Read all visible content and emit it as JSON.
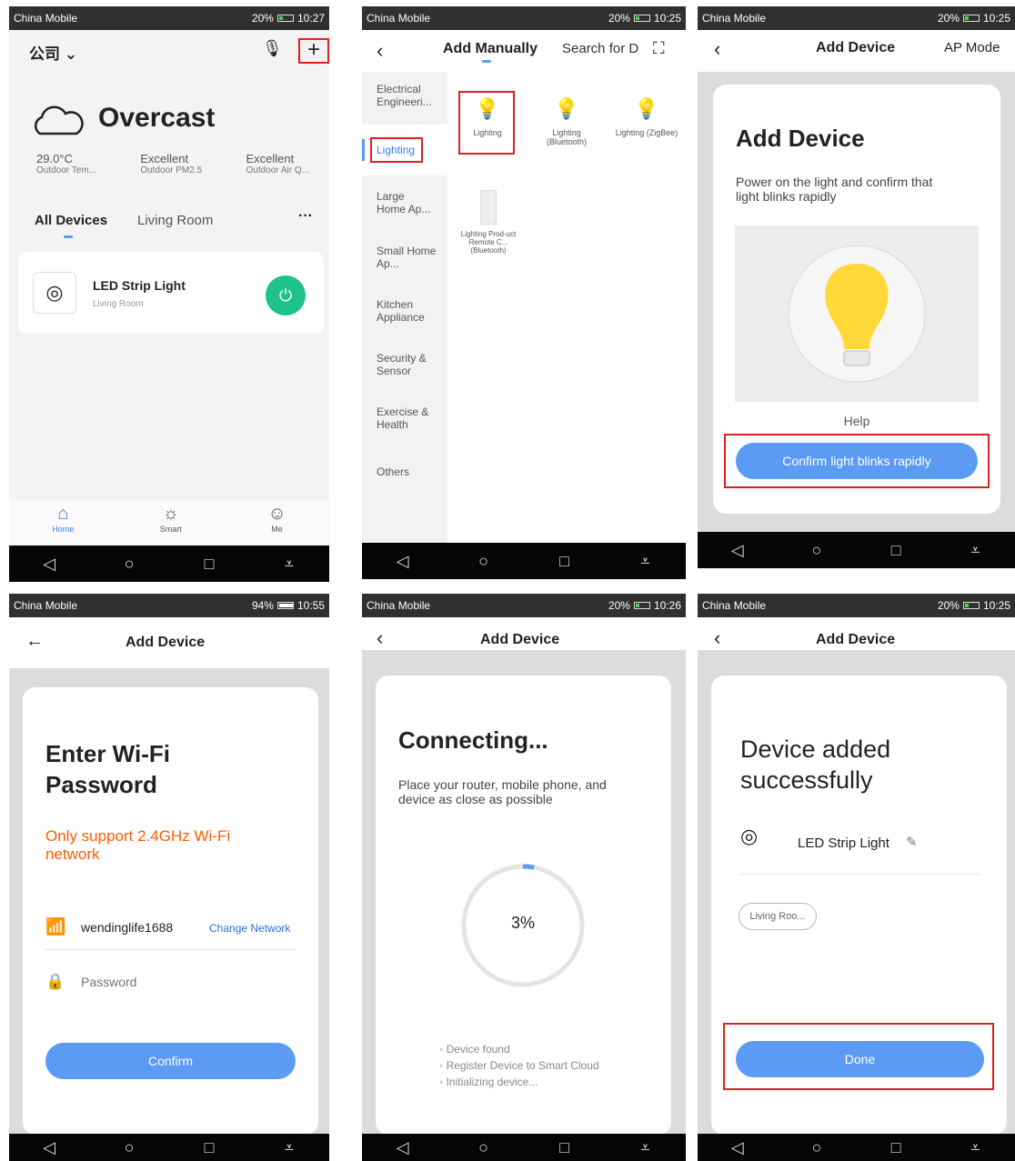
{
  "status": {
    "carrier": "China Mobile",
    "battery": "20%",
    "battery2": "94%",
    "t1": "10:27",
    "t2": "10:25",
    "t3": "10:25",
    "t4": "10:55",
    "t5": "10:26",
    "t6": "10:25"
  },
  "home": {
    "location": "公司",
    "weather": "Overcast",
    "stats": [
      {
        "value": "29.0°C",
        "label": "Outdoor Tem..."
      },
      {
        "value": "Excellent",
        "label": "Outdoor PM2.5"
      },
      {
        "value": "Excellent",
        "label": "Outdoor Air Q..."
      }
    ],
    "tabs": [
      "All Devices",
      "Living Room"
    ],
    "more": "···",
    "device": {
      "name": "LED Strip Light",
      "room": "Living Room"
    },
    "bottom": [
      "Home",
      "Smart",
      "Me"
    ]
  },
  "manual": {
    "title": "Add Manually",
    "search": "Search for D",
    "categories": [
      "Electrical Engineeri...",
      "Lighting",
      "Large Home Ap...",
      "Small Home Ap...",
      "Kitchen Appliance",
      "Security & Sensor",
      "Exercise & Health",
      "Others"
    ],
    "products": [
      "Lighting",
      "Lighting (Bluetooth)",
      "Lighting (ZigBee)",
      "Lighting Prod-uct Remote C... (Bluetooth)"
    ]
  },
  "add": {
    "title": "Add Device",
    "mode": "AP Mode",
    "heading": "Add Device",
    "desc": "Power on the light and confirm that light blinks rapidly",
    "help": "Help",
    "confirm": "Confirm light blinks rapidly"
  },
  "wifi": {
    "title": "Add Device",
    "heading": "Enter Wi-Fi Password",
    "warn": "Only support 2.4GHz Wi-Fi network",
    "ssid": "wendinglife1688",
    "change": "Change Network",
    "placeholder": "Password",
    "confirm": "Confirm"
  },
  "connect": {
    "title": "Add Device",
    "heading": "Connecting...",
    "desc": "Place your router, mobile phone, and device as close as possible",
    "percent": "3%",
    "progress": 0.03,
    "steps": [
      "Device found",
      "Register Device to Smart Cloud",
      "Initializing device..."
    ]
  },
  "done": {
    "title": "Add Device",
    "heading": "Device added successfully",
    "device": "LED Strip Light",
    "room": "Living Roo...",
    "button": "Done"
  },
  "colors": {
    "accent": "#5b9bf3",
    "green": "#1ec28b",
    "warn": "#ff5a00",
    "red": "#e02020"
  }
}
